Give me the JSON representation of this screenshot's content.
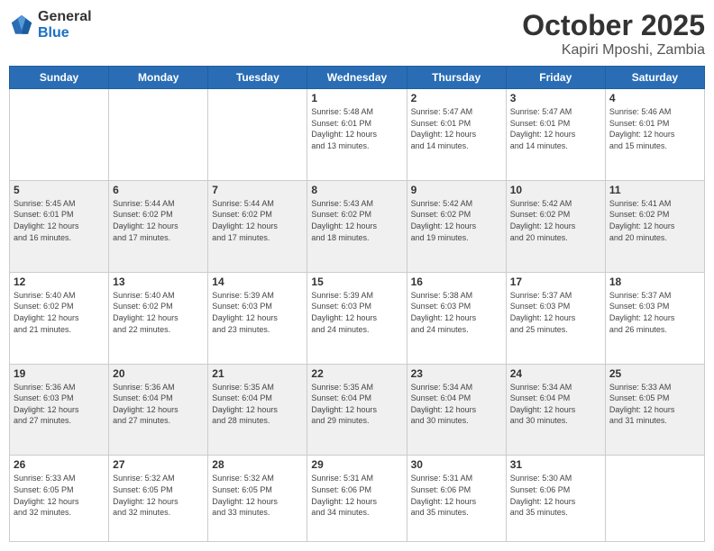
{
  "header": {
    "logo_general": "General",
    "logo_blue": "Blue",
    "month": "October 2025",
    "location": "Kapiri Mposhi, Zambia"
  },
  "weekdays": [
    "Sunday",
    "Monday",
    "Tuesday",
    "Wednesday",
    "Thursday",
    "Friday",
    "Saturday"
  ],
  "weeks": [
    [
      {
        "day": "",
        "info": ""
      },
      {
        "day": "",
        "info": ""
      },
      {
        "day": "",
        "info": ""
      },
      {
        "day": "1",
        "info": "Sunrise: 5:48 AM\nSunset: 6:01 PM\nDaylight: 12 hours\nand 13 minutes."
      },
      {
        "day": "2",
        "info": "Sunrise: 5:47 AM\nSunset: 6:01 PM\nDaylight: 12 hours\nand 14 minutes."
      },
      {
        "day": "3",
        "info": "Sunrise: 5:47 AM\nSunset: 6:01 PM\nDaylight: 12 hours\nand 14 minutes."
      },
      {
        "day": "4",
        "info": "Sunrise: 5:46 AM\nSunset: 6:01 PM\nDaylight: 12 hours\nand 15 minutes."
      }
    ],
    [
      {
        "day": "5",
        "info": "Sunrise: 5:45 AM\nSunset: 6:01 PM\nDaylight: 12 hours\nand 16 minutes."
      },
      {
        "day": "6",
        "info": "Sunrise: 5:44 AM\nSunset: 6:02 PM\nDaylight: 12 hours\nand 17 minutes."
      },
      {
        "day": "7",
        "info": "Sunrise: 5:44 AM\nSunset: 6:02 PM\nDaylight: 12 hours\nand 17 minutes."
      },
      {
        "day": "8",
        "info": "Sunrise: 5:43 AM\nSunset: 6:02 PM\nDaylight: 12 hours\nand 18 minutes."
      },
      {
        "day": "9",
        "info": "Sunrise: 5:42 AM\nSunset: 6:02 PM\nDaylight: 12 hours\nand 19 minutes."
      },
      {
        "day": "10",
        "info": "Sunrise: 5:42 AM\nSunset: 6:02 PM\nDaylight: 12 hours\nand 20 minutes."
      },
      {
        "day": "11",
        "info": "Sunrise: 5:41 AM\nSunset: 6:02 PM\nDaylight: 12 hours\nand 20 minutes."
      }
    ],
    [
      {
        "day": "12",
        "info": "Sunrise: 5:40 AM\nSunset: 6:02 PM\nDaylight: 12 hours\nand 21 minutes."
      },
      {
        "day": "13",
        "info": "Sunrise: 5:40 AM\nSunset: 6:02 PM\nDaylight: 12 hours\nand 22 minutes."
      },
      {
        "day": "14",
        "info": "Sunrise: 5:39 AM\nSunset: 6:03 PM\nDaylight: 12 hours\nand 23 minutes."
      },
      {
        "day": "15",
        "info": "Sunrise: 5:39 AM\nSunset: 6:03 PM\nDaylight: 12 hours\nand 24 minutes."
      },
      {
        "day": "16",
        "info": "Sunrise: 5:38 AM\nSunset: 6:03 PM\nDaylight: 12 hours\nand 24 minutes."
      },
      {
        "day": "17",
        "info": "Sunrise: 5:37 AM\nSunset: 6:03 PM\nDaylight: 12 hours\nand 25 minutes."
      },
      {
        "day": "18",
        "info": "Sunrise: 5:37 AM\nSunset: 6:03 PM\nDaylight: 12 hours\nand 26 minutes."
      }
    ],
    [
      {
        "day": "19",
        "info": "Sunrise: 5:36 AM\nSunset: 6:03 PM\nDaylight: 12 hours\nand 27 minutes."
      },
      {
        "day": "20",
        "info": "Sunrise: 5:36 AM\nSunset: 6:04 PM\nDaylight: 12 hours\nand 27 minutes."
      },
      {
        "day": "21",
        "info": "Sunrise: 5:35 AM\nSunset: 6:04 PM\nDaylight: 12 hours\nand 28 minutes."
      },
      {
        "day": "22",
        "info": "Sunrise: 5:35 AM\nSunset: 6:04 PM\nDaylight: 12 hours\nand 29 minutes."
      },
      {
        "day": "23",
        "info": "Sunrise: 5:34 AM\nSunset: 6:04 PM\nDaylight: 12 hours\nand 30 minutes."
      },
      {
        "day": "24",
        "info": "Sunrise: 5:34 AM\nSunset: 6:04 PM\nDaylight: 12 hours\nand 30 minutes."
      },
      {
        "day": "25",
        "info": "Sunrise: 5:33 AM\nSunset: 6:05 PM\nDaylight: 12 hours\nand 31 minutes."
      }
    ],
    [
      {
        "day": "26",
        "info": "Sunrise: 5:33 AM\nSunset: 6:05 PM\nDaylight: 12 hours\nand 32 minutes."
      },
      {
        "day": "27",
        "info": "Sunrise: 5:32 AM\nSunset: 6:05 PM\nDaylight: 12 hours\nand 32 minutes."
      },
      {
        "day": "28",
        "info": "Sunrise: 5:32 AM\nSunset: 6:05 PM\nDaylight: 12 hours\nand 33 minutes."
      },
      {
        "day": "29",
        "info": "Sunrise: 5:31 AM\nSunset: 6:06 PM\nDaylight: 12 hours\nand 34 minutes."
      },
      {
        "day": "30",
        "info": "Sunrise: 5:31 AM\nSunset: 6:06 PM\nDaylight: 12 hours\nand 35 minutes."
      },
      {
        "day": "31",
        "info": "Sunrise: 5:30 AM\nSunset: 6:06 PM\nDaylight: 12 hours\nand 35 minutes."
      },
      {
        "day": "",
        "info": ""
      }
    ]
  ]
}
